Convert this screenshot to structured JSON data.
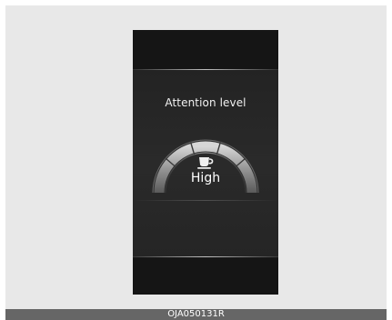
{
  "screen": {
    "title": "Attention level",
    "level_label": "High",
    "gauge_level": 1.0,
    "gauge_segments": 5,
    "icon": "coffee-cup-icon"
  },
  "caption": {
    "code": "OJA050131R"
  },
  "colors": {
    "screen_background": "#1a1a1a",
    "frame_background": "#e8e8e8",
    "caption_bar": "#666666",
    "text": "#ffffff"
  }
}
